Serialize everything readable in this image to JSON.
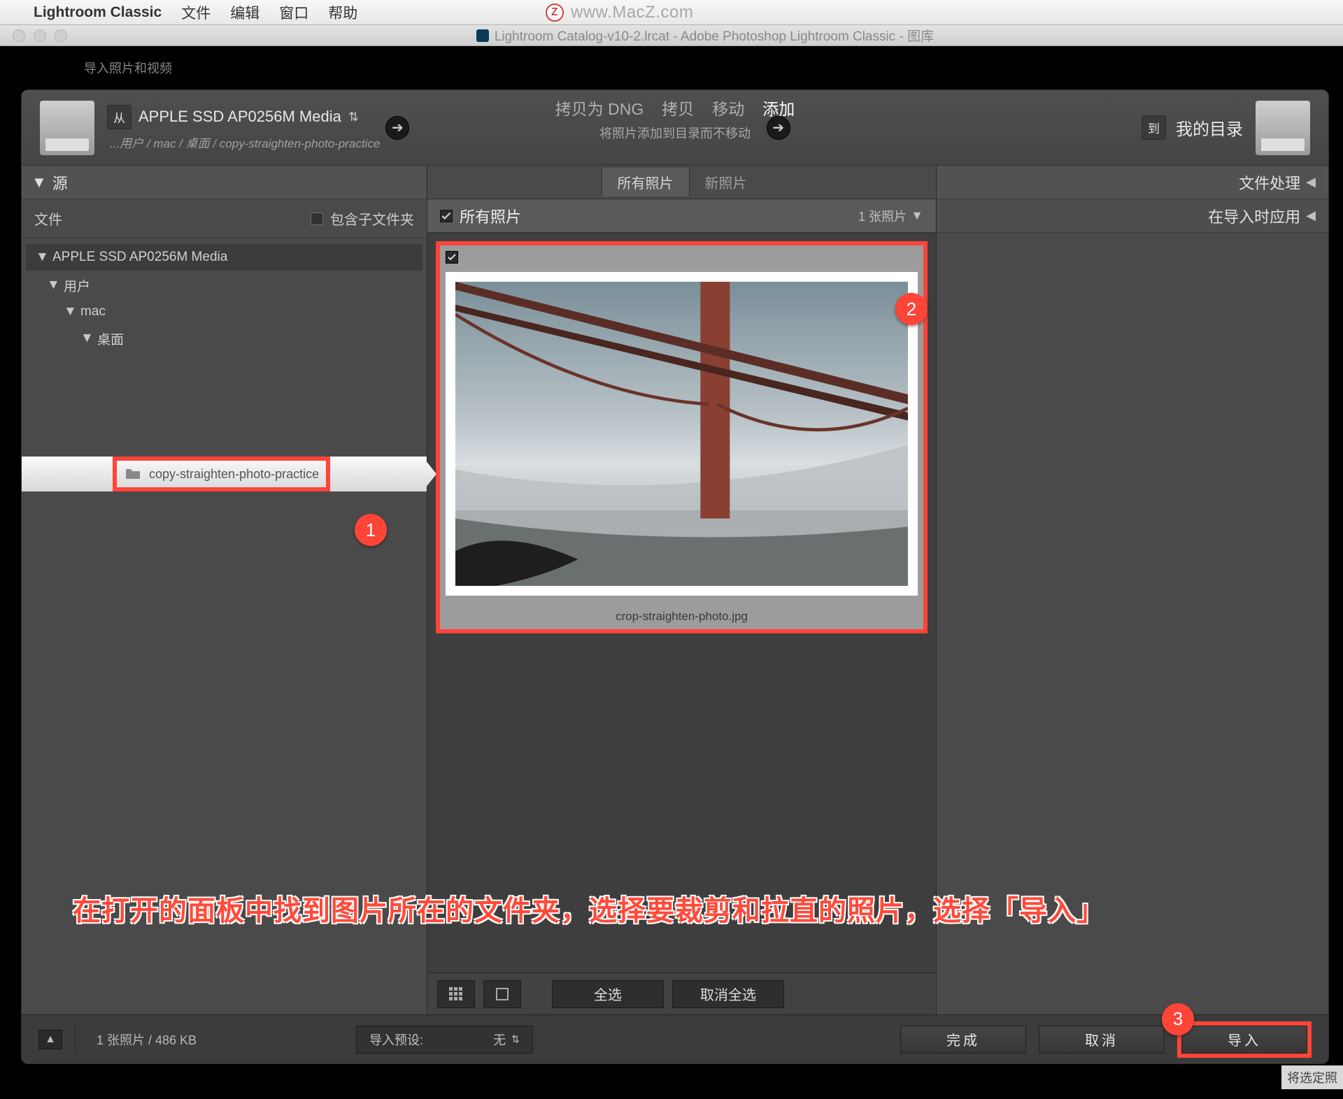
{
  "menubar": {
    "app_name": "Lightroom Classic",
    "items": [
      "文件",
      "编辑",
      "窗口",
      "帮助"
    ]
  },
  "watermark": {
    "z": "Z",
    "url": "www.MacZ.com"
  },
  "window": {
    "title": "Lightroom Catalog-v10-2.lrcat - Adobe Photoshop Lightroom Classic - 图库"
  },
  "strip": {
    "label": "导入照片和视频"
  },
  "header": {
    "from_badge": "从",
    "from_drive": "APPLE SSD AP0256M Media",
    "from_path": "...用户 / mac / 桌面 / copy-straighten-photo-practice",
    "tabs": {
      "copy_dng": "拷贝为 DNG",
      "copy": "拷贝",
      "move": "移动",
      "add": "添加"
    },
    "subtitle": "将照片添加到目录而不移动",
    "to_badge": "到",
    "to_label": "我的目录"
  },
  "left": {
    "source_header": "源",
    "files_label": "文件",
    "include_sub": "包含子文件夹",
    "tree": {
      "root": "APPLE SSD AP0256M Media",
      "l1": "用户",
      "l2": "mac",
      "l3": "桌面",
      "selected": "copy-straighten-photo-practice"
    }
  },
  "mid": {
    "tab_all": "所有照片",
    "tab_new": "新照片",
    "sub_all": "所有照片",
    "count": "1 张照片",
    "thumb_name": "crop-straighten-photo.jpg",
    "select_all": "全选",
    "deselect_all": "取消全选"
  },
  "right": {
    "row1": "文件处理",
    "row2": "在导入时应用"
  },
  "footer": {
    "status": "1 张照片 / 486 KB",
    "preset_label": "导入预设:",
    "preset_value": "无",
    "btn_done": "完成",
    "btn_cancel": "取消",
    "btn_import": "导入"
  },
  "callouts": {
    "c1": "1",
    "c2": "2",
    "c3": "3"
  },
  "instruction": "在打开的面板中找到图片所在的文件夹，选择要裁剪和拉直的照片，选择「导入」",
  "tooltip": "将选定照"
}
